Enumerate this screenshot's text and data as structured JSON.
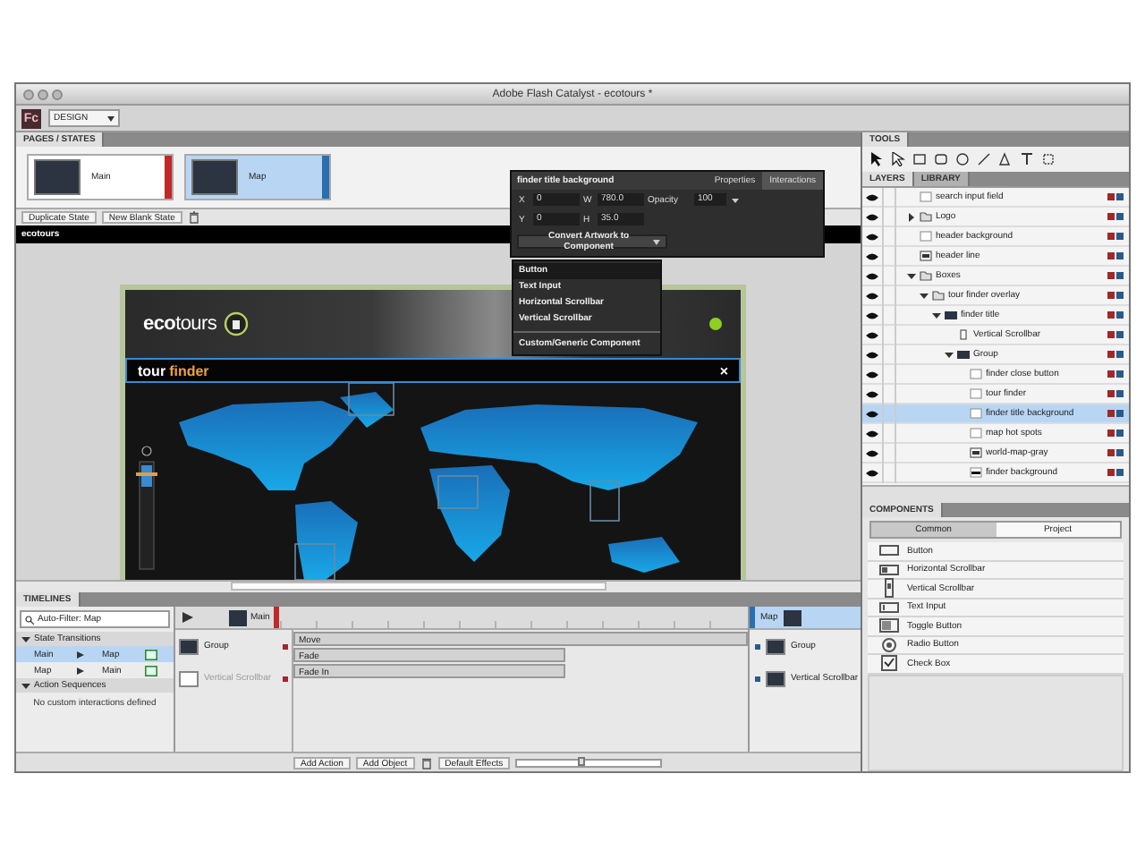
{
  "window": {
    "title": "Adobe Flash Catalyst - ecotours *"
  },
  "toolbar": {
    "logo": "Fc",
    "workspace": "DESIGN"
  },
  "pages_states": {
    "tab": "PAGES / STATES",
    "states": [
      {
        "name": "Main",
        "selected": false,
        "color": "#c0282a"
      },
      {
        "name": "Map",
        "selected": true,
        "color": "#2a6fb0"
      }
    ],
    "buttons": [
      "Duplicate State",
      "New Blank State"
    ]
  },
  "artboard": {
    "title": "ecotours",
    "logo_text": "**eco**tours",
    "finder_title": {
      "first": "tour",
      "second": "finder"
    },
    "close": "×"
  },
  "properties_panel": {
    "title": "finder title background",
    "tabs": [
      {
        "label": "Properties",
        "selected": false
      },
      {
        "label": "Interactions",
        "selected": true
      }
    ],
    "fields": [
      {
        "label": "X",
        "value": "0"
      },
      {
        "label": "W",
        "value": "780.0"
      },
      {
        "label": "Y",
        "value": "0"
      },
      {
        "label": "H",
        "value": "35.0"
      }
    ],
    "opacity": {
      "label": "Opacity",
      "value": "100"
    },
    "convert_button": "Convert Artwork to Component",
    "menu_groups": [
      {
        "items": [
          {
            "label": "Button",
            "selected": true
          },
          {
            "label": "Text Input",
            "selected": false
          },
          {
            "label": "Horizontal Scrollbar",
            "selected": false
          },
          {
            "label": "Vertical Scrollbar",
            "selected": false
          }
        ]
      },
      {
        "items": [
          {
            "label": "Custom/Generic Component",
            "selected": false
          }
        ]
      }
    ]
  },
  "timeline": {
    "tab": "TIMELINES",
    "search": {
      "value": "Auto-Filter: Map"
    },
    "transitions": {
      "label": "State Transitions",
      "expanded": true,
      "rows": [
        {
          "from": "Main",
          "to": "Map",
          "selected": true
        },
        {
          "from": "Map",
          "to": "Main",
          "selected": false
        }
      ]
    },
    "actions": {
      "label": "Action Sequences",
      "expanded": true,
      "empty_text": "No custom interactions defined"
    },
    "from_state": "Main",
    "to_state": "Map",
    "objects": [
      {
        "name": "Group",
        "disabled": false
      },
      {
        "name": "Vertical Scrollbar",
        "disabled": true
      }
    ],
    "effects": [
      {
        "name": "Move",
        "kind": "full"
      },
      {
        "name": "Fade",
        "kind": "half"
      },
      {
        "name": "Fade In",
        "kind": "half"
      }
    ],
    "to_objects": [
      {
        "name": "Group"
      },
      {
        "name": "Vertical Scrollbar"
      }
    ],
    "buttons": [
      "Add Action",
      "Add Object",
      "Default Effects"
    ],
    "zoom": {
      "level": 0.45
    }
  },
  "tools": {
    "tab": "TOOLS"
  },
  "layers": {
    "tabs": [
      {
        "label": "LAYERS",
        "selected": true
      },
      {
        "label": "LIBRARY",
        "selected": false
      }
    ],
    "items": [
      {
        "name": "search input field",
        "kind": "item",
        "selected": false
      },
      {
        "name": "Logo",
        "kind": "folder",
        "expanded": false,
        "selected": false
      },
      {
        "name": "header background",
        "kind": "item",
        "selected": false
      },
      {
        "name": "header line",
        "kind": "image",
        "selected": false
      },
      {
        "name": "Boxes",
        "kind": "folder",
        "expanded": true,
        "selected": false,
        "children": [
          {
            "name": "tour finder overlay",
            "kind": "folder",
            "expanded": true,
            "selected": false,
            "children": [
              {
                "name": "finder title",
                "kind": "group",
                "expanded": true,
                "selected": false,
                "children": [
                  {
                    "name": "Vertical Scrollbar",
                    "kind": "scrollbar",
                    "selected": false
                  },
                  {
                    "name": "Group",
                    "kind": "group",
                    "expanded": true,
                    "selected": false,
                    "children": [
                      {
                        "name": "finder close button",
                        "kind": "item",
                        "selected": false
                      },
                      {
                        "name": "tour finder",
                        "kind": "item",
                        "selected": false
                      },
                      {
                        "name": "finder title background",
                        "kind": "item",
                        "selected": true
                      },
                      {
                        "name": "map hot spots",
                        "kind": "item",
                        "selected": false
                      },
                      {
                        "name": "world-map-gray",
                        "kind": "image",
                        "selected": false
                      },
                      {
                        "name": "finder background",
                        "kind": "line",
                        "selected": false
                      }
                    ]
                  }
                ]
              }
            ]
          }
        ]
      }
    ]
  },
  "components": {
    "tab": "COMPONENTS",
    "tabs": [
      {
        "label": "Common",
        "selected": true
      },
      {
        "label": "Project",
        "selected": false
      }
    ],
    "items": [
      {
        "name": "Button",
        "kind": "button"
      },
      {
        "name": "Horizontal Scrollbar",
        "kind": "hscroll"
      },
      {
        "name": "Vertical Scrollbar",
        "kind": "vscroll"
      },
      {
        "name": "Text Input",
        "kind": "text"
      },
      {
        "name": "Toggle Button",
        "kind": "toggle"
      },
      {
        "name": "Radio Button",
        "kind": "radio"
      },
      {
        "name": "Check Box",
        "kind": "checkbox"
      }
    ]
  }
}
